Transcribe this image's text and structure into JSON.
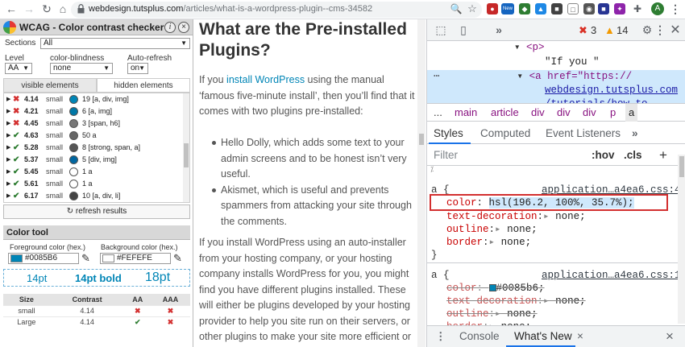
{
  "browser": {
    "url_domain": "webdesign.tutsplus.com",
    "url_path": "/articles/what-is-a-wordpress-plugin--cms-34582",
    "ext_new_badge": "New",
    "profile_initial": "A"
  },
  "wcag": {
    "title": "WCAG - Color contrast checker",
    "info_label": "i",
    "close_label": "×",
    "sections_label": "Sections",
    "sections_value": "All",
    "level_label": "Level",
    "level_value": "AA",
    "blindness_label": "color-blindness",
    "blindness_value": "none",
    "autorefresh_label": "Auto-refresh",
    "autorefresh_value": "on",
    "tab_visible": "visible elements",
    "tab_hidden": "hidden elements",
    "results": [
      {
        "status": "fail",
        "ratio": "4.14",
        "size": "small",
        "color": "#0085B6",
        "count": "19 [a, div, img]"
      },
      {
        "status": "fail",
        "ratio": "4.21",
        "size": "small",
        "color": "#0077a6",
        "count": "6 [a, img]"
      },
      {
        "status": "fail",
        "ratio": "4.45",
        "size": "small",
        "color": "#777777",
        "count": "3 [span, h6]"
      },
      {
        "status": "pass",
        "ratio": "4.63",
        "size": "small",
        "color": "#666666",
        "count": "50 a"
      },
      {
        "status": "pass",
        "ratio": "5.28",
        "size": "small",
        "color": "#555555",
        "count": "8 [strong, span, a]"
      },
      {
        "status": "pass",
        "ratio": "5.37",
        "size": "small",
        "color": "#0066a0",
        "count": "5 [div, img]"
      },
      {
        "status": "pass",
        "ratio": "5.45",
        "size": "small",
        "color": "#ffffff",
        "count": "1 a"
      },
      {
        "status": "pass",
        "ratio": "5.61",
        "size": "small",
        "color": "#ffffff",
        "count": "1 a"
      },
      {
        "status": "pass",
        "ratio": "6.17",
        "size": "small",
        "color": "#444444",
        "count": "10 [a, div, li]"
      }
    ],
    "refresh_label": "refresh results",
    "tool_title": "Color tool",
    "fg_label": "Foreground color (hex.)",
    "fg_value": "#0085B6",
    "fg_color": "#0085B6",
    "bg_label": "Background color (hex.)",
    "bg_value": "#FEFEFE",
    "bg_color": "#FEFEFE",
    "preview": {
      "a": "14pt",
      "b": "14pt bold",
      "c": "18pt"
    },
    "table_headers": [
      "Size",
      "Contrast",
      "AA",
      "AAA"
    ],
    "table_rows": [
      {
        "size": "small",
        "contrast": "4.14",
        "aa": "✖",
        "aaa": "✖"
      },
      {
        "size": "Large",
        "contrast": "4.14",
        "aa": "✔",
        "aaa": "✖"
      }
    ]
  },
  "article": {
    "heading": "What are the Pre-installed Plugins?",
    "p1_a": "If you ",
    "p1_link": "install WordPress",
    "p1_b": " using the manual ‘famous five-minute install’, then you’ll find that it comes with two plugins pre-installed:",
    "bullets": [
      "Hello Dolly, which adds some text to your admin screens and to be honest isn’t very useful.",
      "Akismet, which is useful and prevents spammers from attacking your site through the comments."
    ],
    "p2": "If you install WordPress using an auto-installer from your hosting company, or your hosting company installs WordPress for you, you might find you have different plugins installed. These will either be plugins developed by your hosting provider to help you site run on their servers, or other plugins to make your site more efficient or"
  },
  "devtools": {
    "errors": "3",
    "warnings": "14",
    "dom_lines": [
      "<p>",
      "\"If you \"",
      "<a href=\"https://",
      "webdesign.tutsplus.com",
      "/tutorials/how-to"
    ],
    "crumbs": [
      "...",
      "main",
      "article",
      "div",
      "div",
      "div",
      "p",
      "a"
    ],
    "tabs": [
      "Styles",
      "Computed",
      "Event Listeners",
      "»"
    ],
    "filter_placeholder": "Filter",
    "hov": ":hov",
    "cls": ".cls",
    "plus": "+",
    "rule1_selector": "a {",
    "rule1_source": "application…a4ea6.css:4",
    "rule1_props": [
      {
        "prop": "color",
        "val": "hsl(196.2, 100%, 35.7%);"
      },
      {
        "prop": "text-decoration",
        "val": "none;"
      },
      {
        "prop": "outline",
        "val": "none;"
      },
      {
        "prop": "border",
        "val": "none;"
      }
    ],
    "close_brace": "}",
    "rule2_selector": "a {",
    "rule2_source": "application…a4ea6.css:1",
    "rule2_props": [
      {
        "prop": "color",
        "val": "#0085b6;"
      },
      {
        "prop": "text-decoration",
        "val": "none;"
      },
      {
        "prop": "outline",
        "val": "none;"
      },
      {
        "prop": "border",
        "val": "none;"
      }
    ],
    "drawer_tabs": [
      "Console",
      "What's New"
    ],
    "drawer_close": "×"
  }
}
